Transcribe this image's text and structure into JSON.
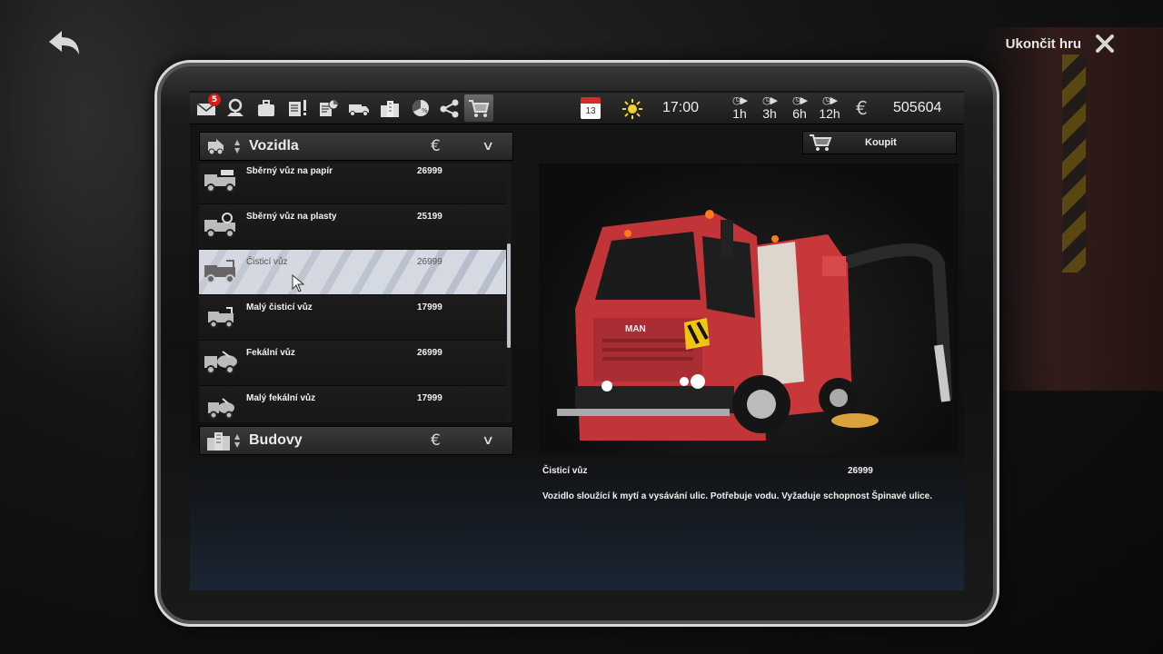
{
  "header": {
    "quit_label": "Ukončit hru"
  },
  "toolbar": {
    "mail_badge": "5",
    "calendar_day": "13",
    "time": "17:00",
    "speeds": [
      "1h",
      "3h",
      "6h",
      "12h"
    ],
    "money": "505604",
    "icons": [
      "mail-icon",
      "map-pin-icon",
      "briefcase-icon",
      "tasks-icon",
      "reports-icon",
      "vehicles-icon",
      "buildings-icon",
      "statistics-icon",
      "share-icon",
      "shop-cart-icon"
    ],
    "active_icon": "shop-cart-icon"
  },
  "categories": [
    {
      "title": "Vozidla",
      "icon": "vehicles-icon",
      "expanded": true
    },
    {
      "title": "Budovy",
      "icon": "buildings-icon",
      "expanded": false
    }
  ],
  "vehicles": [
    {
      "name": "Sběrný vůz na papír",
      "price": "26999",
      "icon": "paper-truck-icon"
    },
    {
      "name": "Sběrný vůz na plasty",
      "price": "25199",
      "icon": "plastic-truck-icon"
    },
    {
      "name": "Čisticí vůz",
      "price": "26999",
      "icon": "sweeper-truck-icon",
      "selected": true
    },
    {
      "name": "Malý čisticí vůz",
      "price": "17999",
      "icon": "small-sweeper-icon"
    },
    {
      "name": "Fekální vůz",
      "price": "26999",
      "icon": "sewage-truck-icon"
    },
    {
      "name": "Malý fekální vůz",
      "price": "17999",
      "icon": "small-sewage-icon"
    }
  ],
  "buy": {
    "label": "Koupit"
  },
  "detail": {
    "name": "Čisticí vůz",
    "price": "26999",
    "description": "Vozidlo sloužící k mytí a vysávání ulic. Potřebuje vodu. Vyžaduje schopnost Špinavé ulice."
  },
  "colors": {
    "accent_red": "#d51e1e",
    "truck_red": "#c8383a",
    "selected_row": "#d6d9e1"
  }
}
